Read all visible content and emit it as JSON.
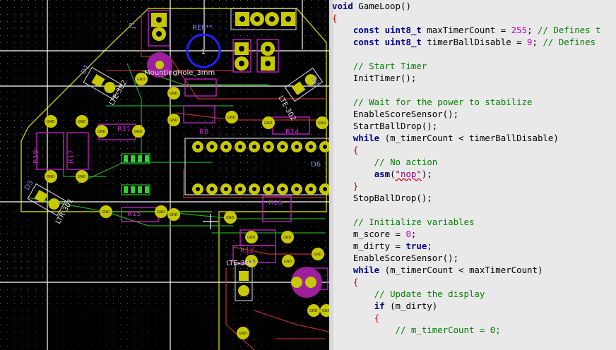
{
  "pcb": {
    "ref_labels": [
      "REF**",
      "MountingHole_3mm",
      "LTE-302",
      "LTE-302",
      "LTE-302",
      "LTR-301",
      "R19",
      "R17",
      "R11",
      "R8",
      "R12",
      "R14",
      "R15",
      "R16",
      "D1",
      "D2",
      "D3",
      "D6",
      "J1"
    ],
    "pad_label": "GND",
    "hole_label": "1"
  },
  "editor": {
    "lines": [
      [
        [
          "void",
          "kw"
        ],
        [
          " GameLoop()",
          "op"
        ]
      ],
      [
        [
          "{",
          "brace"
        ]
      ],
      [
        [
          "    ",
          ""
        ],
        [
          "const",
          "kw"
        ],
        [
          " ",
          ""
        ],
        [
          "uint8_t",
          "type"
        ],
        [
          " maxTimerCount = ",
          "op"
        ],
        [
          "255",
          "num"
        ],
        [
          "; ",
          "op"
        ],
        [
          "// Defines t",
          "cm"
        ]
      ],
      [
        [
          "    ",
          ""
        ],
        [
          "const",
          "kw"
        ],
        [
          " ",
          ""
        ],
        [
          "uint8_t",
          "type"
        ],
        [
          " timerBallDisable = ",
          "op"
        ],
        [
          "9",
          "num"
        ],
        [
          "; ",
          "op"
        ],
        [
          "// Defines",
          "cm"
        ]
      ],
      [
        [
          "",
          ""
        ]
      ],
      [
        [
          "    ",
          ""
        ],
        [
          "// Start Timer",
          "cm"
        ]
      ],
      [
        [
          "    InitTimer();",
          "op"
        ]
      ],
      [
        [
          "",
          ""
        ]
      ],
      [
        [
          "    ",
          ""
        ],
        [
          "// Wait for the power to stabilize",
          "cm"
        ]
      ],
      [
        [
          "    EnableScoreSensor();",
          "op"
        ]
      ],
      [
        [
          "    StartBallDrop();",
          "op"
        ]
      ],
      [
        [
          "    ",
          ""
        ],
        [
          "while",
          "kw"
        ],
        [
          " (m_timerCount < timerBallDisable)",
          "op"
        ]
      ],
      [
        [
          "    ",
          ""
        ],
        [
          "{",
          "brace"
        ]
      ],
      [
        [
          "        ",
          ""
        ],
        [
          "// No action",
          "cm"
        ]
      ],
      [
        [
          "        ",
          ""
        ],
        [
          "asm",
          "kw"
        ],
        [
          "(",
          "op"
        ],
        [
          "\"nop\"",
          "str"
        ],
        [
          ");",
          "op"
        ]
      ],
      [
        [
          "    ",
          ""
        ],
        [
          "}",
          "brace"
        ]
      ],
      [
        [
          "    StopBallDrop();",
          "op"
        ]
      ],
      [
        [
          "",
          ""
        ]
      ],
      [
        [
          "    ",
          ""
        ],
        [
          "// Initialize variables",
          "cm"
        ]
      ],
      [
        [
          "    m_score = ",
          "op"
        ],
        [
          "0",
          "num"
        ],
        [
          ";",
          "op"
        ]
      ],
      [
        [
          "    m_dirty = ",
          "op"
        ],
        [
          "true",
          "kw"
        ],
        [
          ";",
          "op"
        ]
      ],
      [
        [
          "    EnableScoreSensor();",
          "op"
        ]
      ],
      [
        [
          "    ",
          ""
        ],
        [
          "while",
          "kw"
        ],
        [
          " (m_timerCount < maxTimerCount)",
          "op"
        ]
      ],
      [
        [
          "    ",
          ""
        ],
        [
          "{",
          "brace"
        ]
      ],
      [
        [
          "        ",
          ""
        ],
        [
          "// Update the display",
          "cm"
        ]
      ],
      [
        [
          "        ",
          ""
        ],
        [
          "if",
          "kw"
        ],
        [
          " (m_dirty)",
          "op"
        ]
      ],
      [
        [
          "        ",
          ""
        ],
        [
          "{",
          "brace"
        ]
      ],
      [
        [
          "            ",
          ""
        ],
        [
          "// m_timerCount = 0;",
          "cm"
        ]
      ]
    ]
  }
}
